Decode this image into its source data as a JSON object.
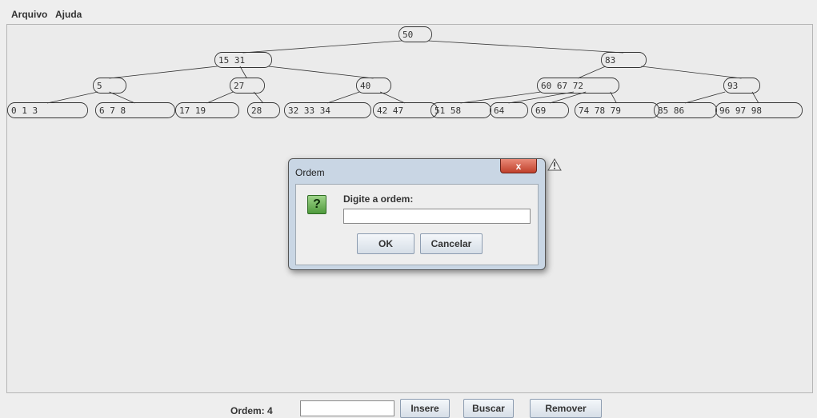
{
  "menu": {
    "file": "Arquivo",
    "help": "Ajuda"
  },
  "tree": {
    "nodes": [
      {
        "label": "50"
      },
      {
        "label": "15 31"
      },
      {
        "label": "83"
      },
      {
        "label": "5"
      },
      {
        "label": "27"
      },
      {
        "label": "40"
      },
      {
        "label": "60 67 72"
      },
      {
        "label": "93"
      },
      {
        "label": "0  1  3"
      },
      {
        "label": "6  7  8"
      },
      {
        "label": "17 19"
      },
      {
        "label": "28"
      },
      {
        "label": "32 33 34"
      },
      {
        "label": "42 47"
      },
      {
        "label": "51 58"
      },
      {
        "label": "64"
      },
      {
        "label": "69"
      },
      {
        "label": "74 78 79"
      },
      {
        "label": "85 86"
      },
      {
        "label": "96 97 98"
      }
    ]
  },
  "dialog": {
    "title": "Ordem",
    "close_label": "x",
    "icon": "question-icon",
    "icon_glyph": "?",
    "prompt": "Digite a ordem:",
    "input_value": "",
    "ok_label": "OK",
    "cancel_label": "Cancelar"
  },
  "bottom": {
    "order_label": "Ordem: 4",
    "input_value": "",
    "insert_label": "Insere",
    "search_label": "Buscar",
    "remove_label": "Remover"
  },
  "colors": {
    "background": "#eeeeee",
    "canvas": "#ebebeb",
    "node_stroke": "#333333"
  }
}
